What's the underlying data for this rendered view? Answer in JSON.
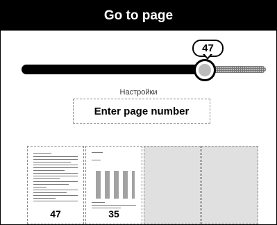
{
  "dialog": {
    "title": "Go to page"
  },
  "slider": {
    "current_page_label": "47",
    "position_fraction": 0.75
  },
  "settings": {
    "label": "Настройки"
  },
  "page_input": {
    "placeholder": "Enter page number"
  },
  "thumbnails": [
    {
      "page_label": "47",
      "empty": false
    },
    {
      "page_label": "35",
      "empty": false
    },
    {
      "page_label": "",
      "empty": true
    },
    {
      "page_label": "",
      "empty": true
    }
  ]
}
